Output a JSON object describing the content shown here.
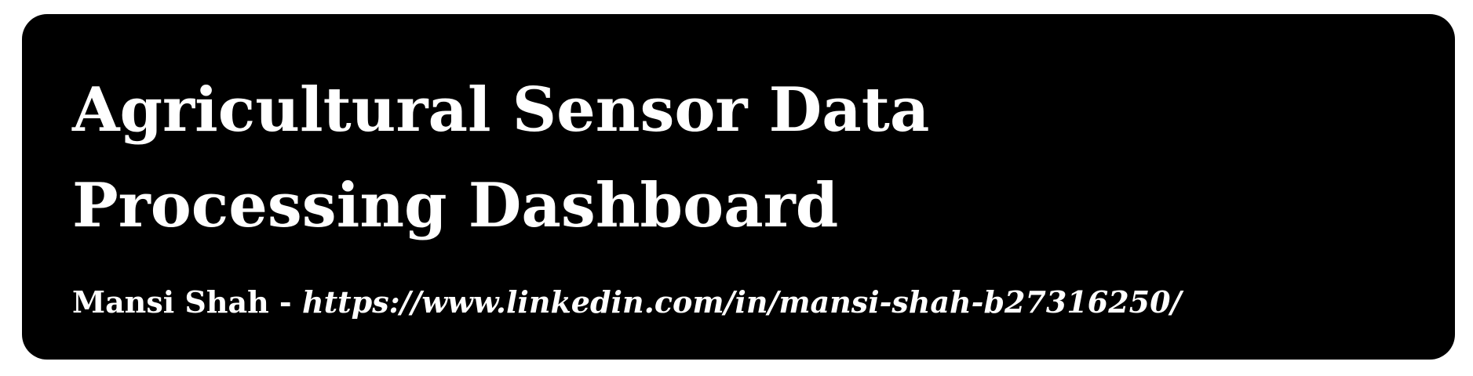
{
  "header": {
    "title_line1": "Agricultural Sensor Data",
    "title_line2": "Processing Dashboard",
    "author": "Mansi Shah",
    "separator": " - ",
    "link": "https://www.linkedin.com/in/mansi-shah-b27316250/"
  },
  "colors": {
    "background": "#000000",
    "text": "#ffffff",
    "page": "#ffffff"
  }
}
